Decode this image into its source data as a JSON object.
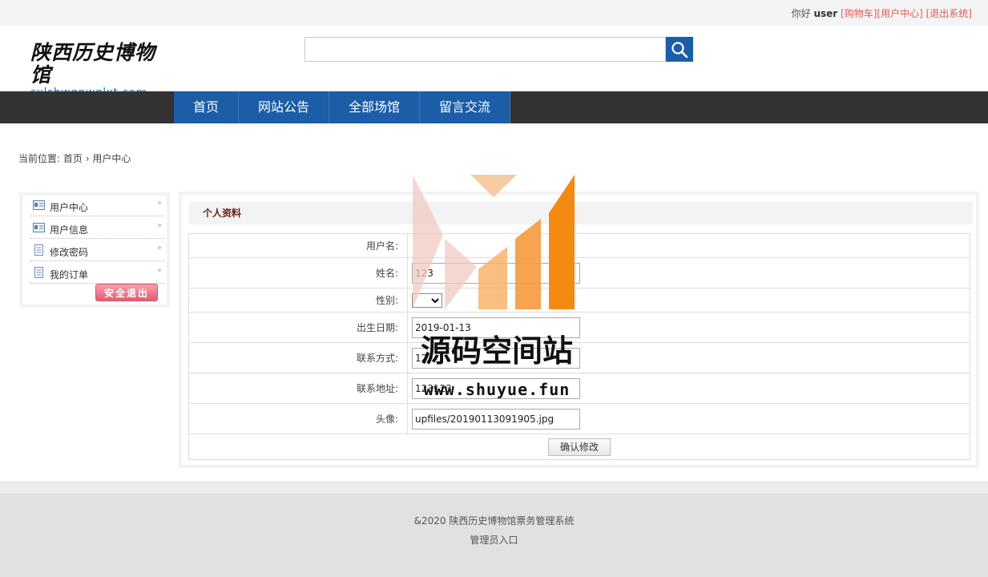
{
  "topbar": {
    "greeting": "你好",
    "username": "user",
    "cart_link": "[购物车]",
    "center_link": "[用户中心]",
    "logout_link": "[退出系统]"
  },
  "logo": {
    "calligraphy": "陕西历史博物馆",
    "domain": "sxlsbwgpwglxt.com"
  },
  "search": {
    "placeholder": "",
    "icon": "search-icon"
  },
  "nav": {
    "items": [
      "首页",
      "网站公告",
      "全部场馆",
      "留言交流"
    ]
  },
  "breadcrumb": {
    "prefix": "当前位置:",
    "home": "首页",
    "sep": "›",
    "current": "用户中心"
  },
  "sidebar": {
    "items": [
      {
        "label": "用户中心",
        "icon": "id-card-icon"
      },
      {
        "label": "用户信息",
        "icon": "id-card-icon"
      },
      {
        "label": "修改密码",
        "icon": "document-icon"
      },
      {
        "label": "我的订单",
        "icon": "document-icon"
      }
    ],
    "logout_button": "安全退出"
  },
  "profile": {
    "title": "个人资料",
    "fields": {
      "username_label": "用户名:",
      "username_value": "",
      "name_label": "姓名:",
      "name_value": "123",
      "gender_label": "性别:",
      "gender_value": "",
      "birth_label": "出生日期:",
      "birth_value": "2019-01-13",
      "contact_label": "联系方式:",
      "contact_value": "12",
      "address_label": "联系地址:",
      "address_value": "123123",
      "avatar_label": "头像:",
      "avatar_value": "upfiles/20190113091905.jpg"
    },
    "submit_label": "确认修改"
  },
  "footer": {
    "copyright": "&2020 陕西历史博物馆票务管理系统",
    "admin_link": "管理员入口"
  },
  "watermark": {
    "text": "源码空间站",
    "url": "www.shuyue.fun"
  },
  "colors": {
    "nav_blue": "#1b5da6",
    "nav_bar": "#333333",
    "link_red": "#e05a4f",
    "logout_pink": "#e05d72"
  }
}
